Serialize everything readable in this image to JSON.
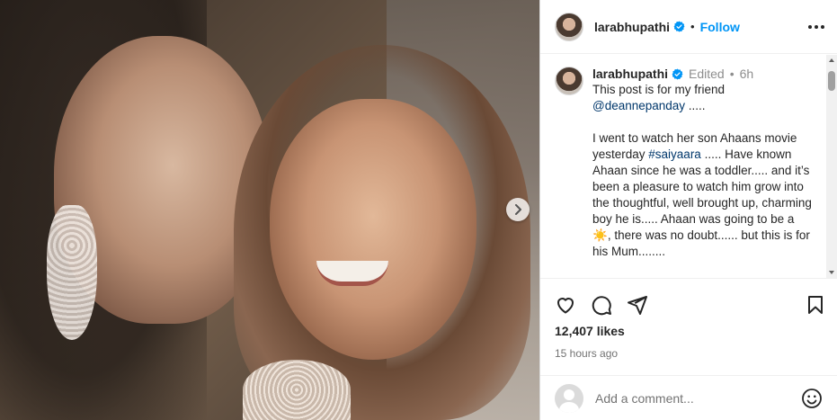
{
  "post": {
    "username": "larabhupathi",
    "follow_label": "Follow",
    "separator": "•"
  },
  "caption": {
    "username": "larabhupathi",
    "edited_label": "Edited",
    "dot": "•",
    "time": "6h",
    "text_1": "This post is for my friend\n",
    "mention": "@deannepanday",
    "text_2": " .....\n\nI went to watch her son Ahaans movie yesterday ",
    "hashtag": "#saiyaara",
    "text_3": " ..... Have known Ahaan since he was a toddler..... and it’s been a pleasure to watch him grow into the thoughtful, well brought up, charming boy he is..... Ahaan was going to be a ",
    "star_emoji": "☀️",
    "text_4": ", there was no doubt...... but this is for his Mum........"
  },
  "engagement": {
    "likes": "12,407 likes",
    "time_ago": "15 hours ago"
  },
  "comment": {
    "placeholder": "Add a comment..."
  },
  "icons": {
    "verified": "verified-badge-icon",
    "more": "more-options-icon",
    "like": "heart-icon",
    "comment": "comment-bubble-icon",
    "share": "paper-plane-icon",
    "save": "bookmark-icon",
    "emoji": "smiley-icon",
    "next": "chevron-right-icon"
  },
  "colors": {
    "accent": "#0095f6",
    "verified": "#0095f6",
    "mention": "#00376b",
    "muted": "#8e8e8e"
  }
}
